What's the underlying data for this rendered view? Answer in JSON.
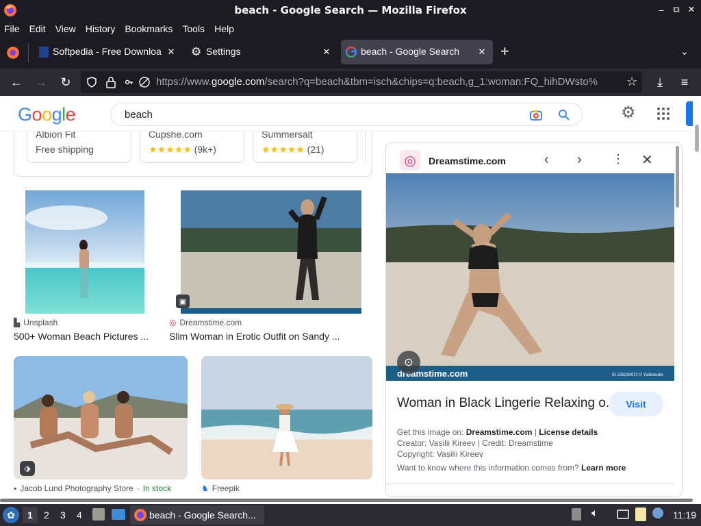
{
  "window": {
    "title": "beach - Google Search — Mozilla Firefox"
  },
  "menu": [
    "File",
    "Edit",
    "View",
    "History",
    "Bookmarks",
    "Tools",
    "Help"
  ],
  "tabs": [
    {
      "label": "Softpedia - Free Downloa",
      "icon": "softpedia-icon"
    },
    {
      "label": "Settings",
      "icon": "gear-icon"
    },
    {
      "label": "beach - Google Search",
      "icon": "google-icon",
      "active": true
    }
  ],
  "url": {
    "prefix": "https://www.",
    "domain": "google.com",
    "rest": "/search?q=beach&tbm=isch&chips=q:beach,g_1:woman:FQ_hihDWsto%"
  },
  "google": {
    "logo": "Google",
    "query": "beach"
  },
  "shopping": [
    {
      "store": "Albion Fit",
      "detail": "Free shipping"
    },
    {
      "store": "Cupshe.com",
      "rating": "★★★★★",
      "count": "(9k+)"
    },
    {
      "store": "Summersalt",
      "rating": "★★★★★",
      "count": "(21)"
    }
  ],
  "results": [
    {
      "source": "Unsplash",
      "caption": "500+ Woman Beach Pictures ..."
    },
    {
      "source": "Dreamstime.com",
      "caption": "Slim Woman in Erotic Outfit on Sandy ..."
    },
    {
      "source": "Jacob Lund Photography Store",
      "stock": "In stock",
      "caption": ""
    },
    {
      "source": "Freepik",
      "caption": ""
    }
  ],
  "panel": {
    "site": "Dreamstime.com",
    "watermark": "dreamstime.com",
    "image_id": "ID 225230972 © Ya3kstudio",
    "title": "Woman in Black Lingerie Relaxing o...",
    "visit": "Visit",
    "get_image_label": "Get this image on:",
    "get_image_site": "Dreamstime.com",
    "sep": "|",
    "license": "License details",
    "creator": "Creator: Vasilii Kireev | Credit: Dreamstime",
    "copyright": "Copyright: Vasilii Kireev",
    "info_q": "Want to know where this information comes from?",
    "learn_more": "Learn more"
  },
  "taskbar": {
    "workspaces": [
      "1",
      "2",
      "3",
      "4"
    ],
    "app": "beach - Google Search...",
    "time": "11:19"
  },
  "colors": {
    "accent": "#1a73e8",
    "ff_dark": "#1c1b22",
    "instock": "#188038"
  }
}
